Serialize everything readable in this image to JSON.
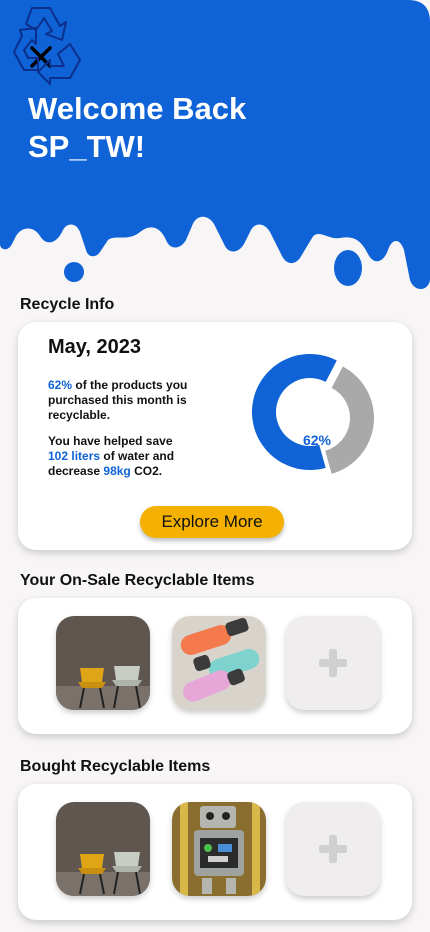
{
  "header": {
    "close_label": "close",
    "welcome_line1": "Welcome Back",
    "welcome_line2": "SP_TW!"
  },
  "recycle_info": {
    "section_title": "Recycle Info",
    "month": "May, 2023",
    "percent_text": "62%",
    "percent_value": 62,
    "sentence1_rest": " of the products you purchased this month is recyclable.",
    "sentence2_start": "You have helped save ",
    "water_amount": "102 liters",
    "sentence2_mid": " of water and decrease ",
    "co2_amount": "98kg",
    "sentence2_end": " CO2.",
    "explore_label": "Explore More",
    "donut_colors": {
      "recyclable": "#0f63d6",
      "rest": "#a9a9a9"
    }
  },
  "on_sale": {
    "section_title": "Your On-Sale Recyclable Items",
    "items": [
      "chairs",
      "bottles"
    ],
    "add_label": "add item"
  },
  "bought": {
    "section_title": "Bought Recyclable Items",
    "items": [
      "chairs",
      "robot"
    ],
    "add_label": "add item"
  },
  "colors": {
    "brand_blue": "#0f63d6",
    "accent_yellow": "#f5b100",
    "background": "#f7f5f6"
  }
}
